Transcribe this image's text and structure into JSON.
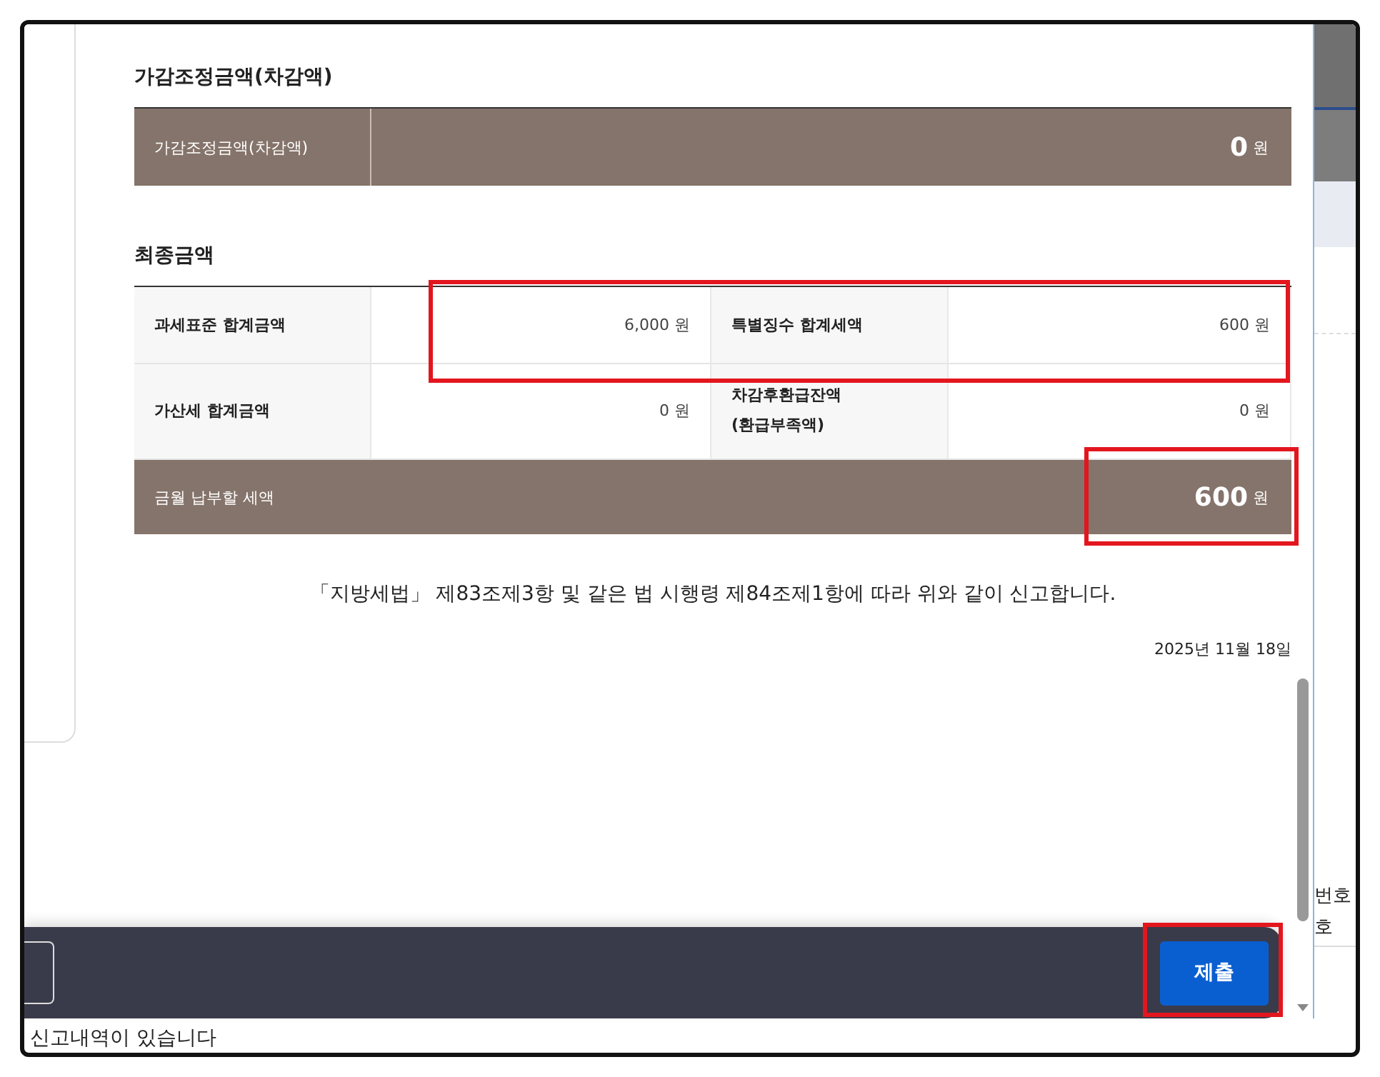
{
  "adjustment": {
    "title": "가감조정금액(차감액)",
    "label": "가감조정금액(차감액)",
    "amount": "**0** 원"
  },
  "final": {
    "title": "최종금액",
    "rows": [
      [
        {
          "label": [
            "과세표준 합계금액"
          ],
          "amount": "6,000 원"
        },
        {
          "label": [
            "특별징수 합계세액"
          ],
          "amount": "600 원"
        }
      ],
      [
        {
          "label": [
            "가산세 합계금액"
          ],
          "amount": "0 원"
        },
        {
          "label": [
            "차감후환급잔액",
            "(환급부족액)"
          ],
          "amount": "0 원"
        }
      ]
    ],
    "total": {
      "label": "금월 납부할 세액",
      "amount": "**600** 원"
    }
  },
  "declaration": "「지방세법」 제83조제3항 및 같은 법 시행령 제84조제1항에 따라 위와 같이 신고합니다.",
  "date": "2025년 11월 18일",
  "footer": {
    "submit": "제출"
  },
  "background": {
    "side_texts": [
      "번호",
      "호"
    ],
    "notice": "신고내역이 있습니다"
  }
}
